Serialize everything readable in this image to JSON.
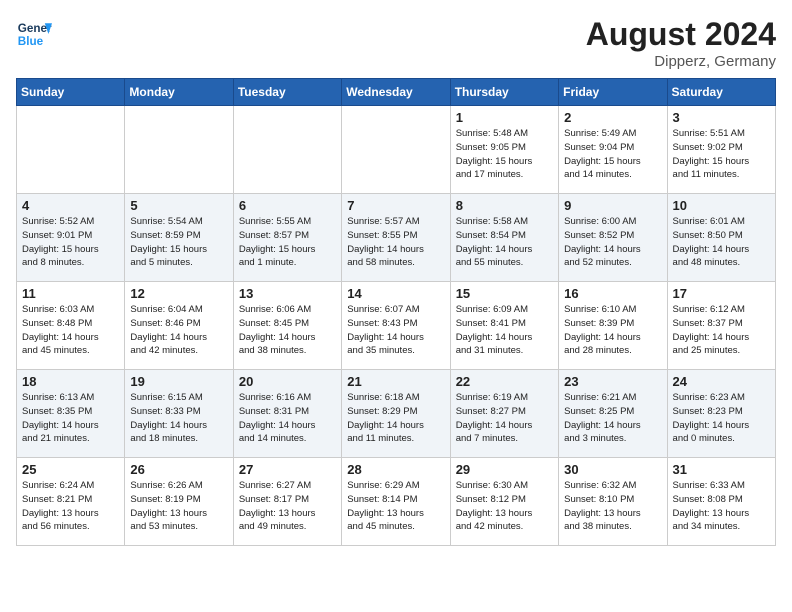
{
  "header": {
    "logo_line1": "General",
    "logo_line2": "Blue",
    "month_year": "August 2024",
    "location": "Dipperz, Germany"
  },
  "days_of_week": [
    "Sunday",
    "Monday",
    "Tuesday",
    "Wednesday",
    "Thursday",
    "Friday",
    "Saturday"
  ],
  "weeks": [
    [
      {
        "day": "",
        "info": ""
      },
      {
        "day": "",
        "info": ""
      },
      {
        "day": "",
        "info": ""
      },
      {
        "day": "",
        "info": ""
      },
      {
        "day": "1",
        "info": "Sunrise: 5:48 AM\nSunset: 9:05 PM\nDaylight: 15 hours\nand 17 minutes."
      },
      {
        "day": "2",
        "info": "Sunrise: 5:49 AM\nSunset: 9:04 PM\nDaylight: 15 hours\nand 14 minutes."
      },
      {
        "day": "3",
        "info": "Sunrise: 5:51 AM\nSunset: 9:02 PM\nDaylight: 15 hours\nand 11 minutes."
      }
    ],
    [
      {
        "day": "4",
        "info": "Sunrise: 5:52 AM\nSunset: 9:01 PM\nDaylight: 15 hours\nand 8 minutes."
      },
      {
        "day": "5",
        "info": "Sunrise: 5:54 AM\nSunset: 8:59 PM\nDaylight: 15 hours\nand 5 minutes."
      },
      {
        "day": "6",
        "info": "Sunrise: 5:55 AM\nSunset: 8:57 PM\nDaylight: 15 hours\nand 1 minute."
      },
      {
        "day": "7",
        "info": "Sunrise: 5:57 AM\nSunset: 8:55 PM\nDaylight: 14 hours\nand 58 minutes."
      },
      {
        "day": "8",
        "info": "Sunrise: 5:58 AM\nSunset: 8:54 PM\nDaylight: 14 hours\nand 55 minutes."
      },
      {
        "day": "9",
        "info": "Sunrise: 6:00 AM\nSunset: 8:52 PM\nDaylight: 14 hours\nand 52 minutes."
      },
      {
        "day": "10",
        "info": "Sunrise: 6:01 AM\nSunset: 8:50 PM\nDaylight: 14 hours\nand 48 minutes."
      }
    ],
    [
      {
        "day": "11",
        "info": "Sunrise: 6:03 AM\nSunset: 8:48 PM\nDaylight: 14 hours\nand 45 minutes."
      },
      {
        "day": "12",
        "info": "Sunrise: 6:04 AM\nSunset: 8:46 PM\nDaylight: 14 hours\nand 42 minutes."
      },
      {
        "day": "13",
        "info": "Sunrise: 6:06 AM\nSunset: 8:45 PM\nDaylight: 14 hours\nand 38 minutes."
      },
      {
        "day": "14",
        "info": "Sunrise: 6:07 AM\nSunset: 8:43 PM\nDaylight: 14 hours\nand 35 minutes."
      },
      {
        "day": "15",
        "info": "Sunrise: 6:09 AM\nSunset: 8:41 PM\nDaylight: 14 hours\nand 31 minutes."
      },
      {
        "day": "16",
        "info": "Sunrise: 6:10 AM\nSunset: 8:39 PM\nDaylight: 14 hours\nand 28 minutes."
      },
      {
        "day": "17",
        "info": "Sunrise: 6:12 AM\nSunset: 8:37 PM\nDaylight: 14 hours\nand 25 minutes."
      }
    ],
    [
      {
        "day": "18",
        "info": "Sunrise: 6:13 AM\nSunset: 8:35 PM\nDaylight: 14 hours\nand 21 minutes."
      },
      {
        "day": "19",
        "info": "Sunrise: 6:15 AM\nSunset: 8:33 PM\nDaylight: 14 hours\nand 18 minutes."
      },
      {
        "day": "20",
        "info": "Sunrise: 6:16 AM\nSunset: 8:31 PM\nDaylight: 14 hours\nand 14 minutes."
      },
      {
        "day": "21",
        "info": "Sunrise: 6:18 AM\nSunset: 8:29 PM\nDaylight: 14 hours\nand 11 minutes."
      },
      {
        "day": "22",
        "info": "Sunrise: 6:19 AM\nSunset: 8:27 PM\nDaylight: 14 hours\nand 7 minutes."
      },
      {
        "day": "23",
        "info": "Sunrise: 6:21 AM\nSunset: 8:25 PM\nDaylight: 14 hours\nand 3 minutes."
      },
      {
        "day": "24",
        "info": "Sunrise: 6:23 AM\nSunset: 8:23 PM\nDaylight: 14 hours\nand 0 minutes."
      }
    ],
    [
      {
        "day": "25",
        "info": "Sunrise: 6:24 AM\nSunset: 8:21 PM\nDaylight: 13 hours\nand 56 minutes."
      },
      {
        "day": "26",
        "info": "Sunrise: 6:26 AM\nSunset: 8:19 PM\nDaylight: 13 hours\nand 53 minutes."
      },
      {
        "day": "27",
        "info": "Sunrise: 6:27 AM\nSunset: 8:17 PM\nDaylight: 13 hours\nand 49 minutes."
      },
      {
        "day": "28",
        "info": "Sunrise: 6:29 AM\nSunset: 8:14 PM\nDaylight: 13 hours\nand 45 minutes."
      },
      {
        "day": "29",
        "info": "Sunrise: 6:30 AM\nSunset: 8:12 PM\nDaylight: 13 hours\nand 42 minutes."
      },
      {
        "day": "30",
        "info": "Sunrise: 6:32 AM\nSunset: 8:10 PM\nDaylight: 13 hours\nand 38 minutes."
      },
      {
        "day": "31",
        "info": "Sunrise: 6:33 AM\nSunset: 8:08 PM\nDaylight: 13 hours\nand 34 minutes."
      }
    ]
  ]
}
